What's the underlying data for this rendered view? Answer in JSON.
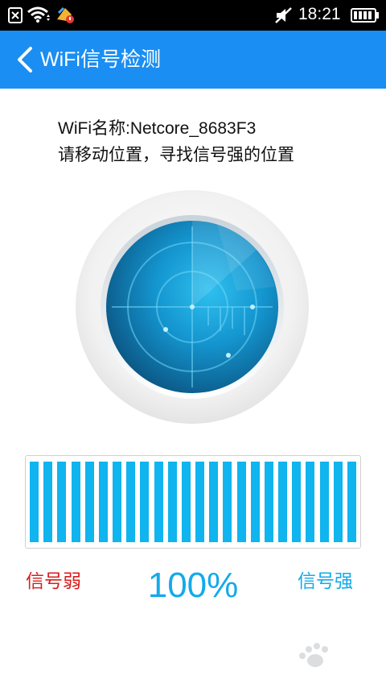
{
  "status": {
    "time": "18:21"
  },
  "header": {
    "title": "WiFi信号检测"
  },
  "info": {
    "wifi_name": "WiFi名称:Netcore_8683F3",
    "hint": "请移动位置，寻找信号强的位置"
  },
  "meter": {
    "level": 1.0,
    "bar_count": 24,
    "bar_color": "#10b4ee"
  },
  "labels": {
    "weak": "信号弱",
    "percent": "100%",
    "strong": "信号强"
  },
  "colors": {
    "header": "#1a8ef2",
    "weak": "#d81e1e",
    "strong": "#13aaea"
  }
}
